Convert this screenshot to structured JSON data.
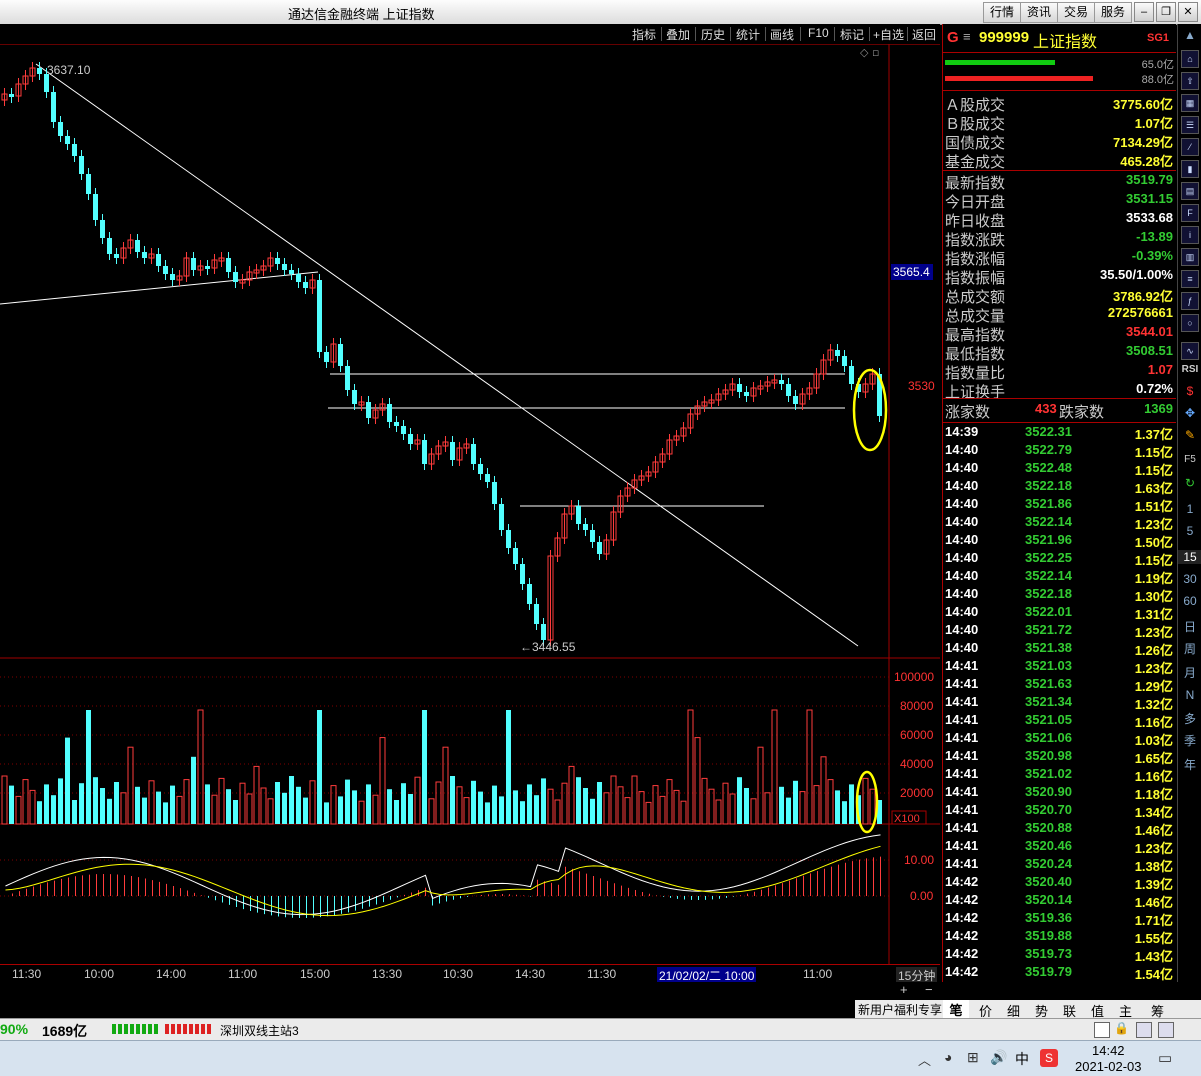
{
  "window": {
    "title": "通达信金融终端  上证指数",
    "menu_buttons": [
      "行情",
      "资讯",
      "交易",
      "服务"
    ]
  },
  "toolbar": {
    "items": [
      "指标",
      "叠加",
      "历史",
      "统计",
      "画线",
      "F10",
      "标记",
      "+自选",
      "返回"
    ]
  },
  "chart": {
    "high_label": "3637.10",
    "low_label": "←3446.55",
    "price_label_a": "3565.4",
    "price_label_b": "3530",
    "vol_axis": [
      "100000",
      "80000",
      "60000",
      "40000",
      "20000"
    ],
    "vol_unit": "X100",
    "macd_axis": [
      "10.00",
      "0.00"
    ],
    "time_labels": [
      "11:30",
      "10:00",
      "14:00",
      "11:00",
      "15:00",
      "13:30",
      "10:30",
      "14:30",
      "11:30",
      "21/02/02/二 10:00",
      "11:00"
    ],
    "period": "15分钟",
    "plus": "+",
    "minus": "−",
    "colors": {
      "up": "#ff3c3c",
      "down": "#52ffff",
      "axis": "#a00000"
    }
  },
  "quote": {
    "prefix": "G",
    "code": "999999",
    "name": "上证指数",
    "tag": "SG1",
    "bar_values": [
      "65.0亿",
      "88.0亿"
    ],
    "turnover": [
      {
        "k": "Ａ股成交",
        "v": "3775.60亿"
      },
      {
        "k": "Ｂ股成交",
        "v": "1.07亿"
      },
      {
        "k": "国债成交",
        "v": "7134.29亿"
      },
      {
        "k": "基金成交",
        "v": "465.28亿"
      }
    ],
    "stats": [
      {
        "k": "最新指数",
        "v": "3519.79",
        "c": "#3c3"
      },
      {
        "k": "今日开盘",
        "v": "3531.15",
        "c": "#3c3"
      },
      {
        "k": "昨日收盘",
        "v": "3533.68",
        "c": "#fff"
      },
      {
        "k": "指数涨跌",
        "v": "-13.89",
        "c": "#3c3"
      },
      {
        "k": "指数涨幅",
        "v": "-0.39%",
        "c": "#3c3"
      },
      {
        "k": "指数振幅",
        "v": "35.50/1.00%",
        "c": "#fff"
      },
      {
        "k": "总成交额",
        "v": "3786.92亿",
        "c": "#ff3"
      },
      {
        "k": "总成交量",
        "v": "272576661",
        "c": "#ff3"
      },
      {
        "k": "最高指数",
        "v": "3544.01",
        "c": "#f33"
      },
      {
        "k": "最低指数",
        "v": "3508.51",
        "c": "#3c3"
      },
      {
        "k": "指数量比",
        "v": "1.07",
        "c": "#f33"
      },
      {
        "k": "上证换手",
        "v": "0.72%",
        "c": "#fff"
      }
    ],
    "breadth": {
      "up_label": "涨家数",
      "up": "433",
      "down_label": "跌家数",
      "down": "1369"
    }
  },
  "ticks": [
    [
      "14:39",
      "3522.31",
      "1.37亿"
    ],
    [
      "14:40",
      "3522.79",
      "1.15亿"
    ],
    [
      "14:40",
      "3522.48",
      "1.15亿"
    ],
    [
      "14:40",
      "3522.18",
      "1.63亿"
    ],
    [
      "14:40",
      "3521.86",
      "1.51亿"
    ],
    [
      "14:40",
      "3522.14",
      "1.23亿"
    ],
    [
      "14:40",
      "3521.96",
      "1.50亿"
    ],
    [
      "14:40",
      "3522.25",
      "1.15亿"
    ],
    [
      "14:40",
      "3522.14",
      "1.19亿"
    ],
    [
      "14:40",
      "3522.18",
      "1.30亿"
    ],
    [
      "14:40",
      "3522.01",
      "1.31亿"
    ],
    [
      "14:40",
      "3521.72",
      "1.23亿"
    ],
    [
      "14:40",
      "3521.38",
      "1.26亿"
    ],
    [
      "14:41",
      "3521.03",
      "1.23亿"
    ],
    [
      "14:41",
      "3521.63",
      "1.29亿"
    ],
    [
      "14:41",
      "3521.34",
      "1.32亿"
    ],
    [
      "14:41",
      "3521.05",
      "1.16亿"
    ],
    [
      "14:41",
      "3521.06",
      "1.03亿"
    ],
    [
      "14:41",
      "3520.98",
      "1.65亿"
    ],
    [
      "14:41",
      "3521.02",
      "1.16亿"
    ],
    [
      "14:41",
      "3520.90",
      "1.18亿"
    ],
    [
      "14:41",
      "3520.70",
      "1.34亿"
    ],
    [
      "14:41",
      "3520.88",
      "1.46亿"
    ],
    [
      "14:41",
      "3520.46",
      "1.23亿"
    ],
    [
      "14:41",
      "3520.24",
      "1.38亿"
    ],
    [
      "14:42",
      "3520.40",
      "1.39亿"
    ],
    [
      "14:42",
      "3520.14",
      "1.46亿"
    ],
    [
      "14:42",
      "3519.36",
      "1.71亿"
    ],
    [
      "14:42",
      "3519.88",
      "1.55亿"
    ],
    [
      "14:42",
      "3519.73",
      "1.43亿"
    ],
    [
      "14:42",
      "3519.79",
      "1.54亿"
    ]
  ],
  "side_icons": [
    "RSI",
    "F5"
  ],
  "side_periods": [
    "1",
    "5",
    "15",
    "30",
    "60",
    "日",
    "周",
    "月",
    "N",
    "多",
    "季",
    "年"
  ],
  "bottom_tabs": [
    "新用户福利专享",
    "笔",
    "价",
    "细",
    "势",
    "联",
    "值",
    "主",
    "筹"
  ],
  "status": {
    "pct": "90%",
    "amount": "1689亿",
    "server": "深圳双线主站3"
  },
  "taskbar": {
    "ime": "中",
    "time": "14:42",
    "date": "2021-02-03"
  }
}
